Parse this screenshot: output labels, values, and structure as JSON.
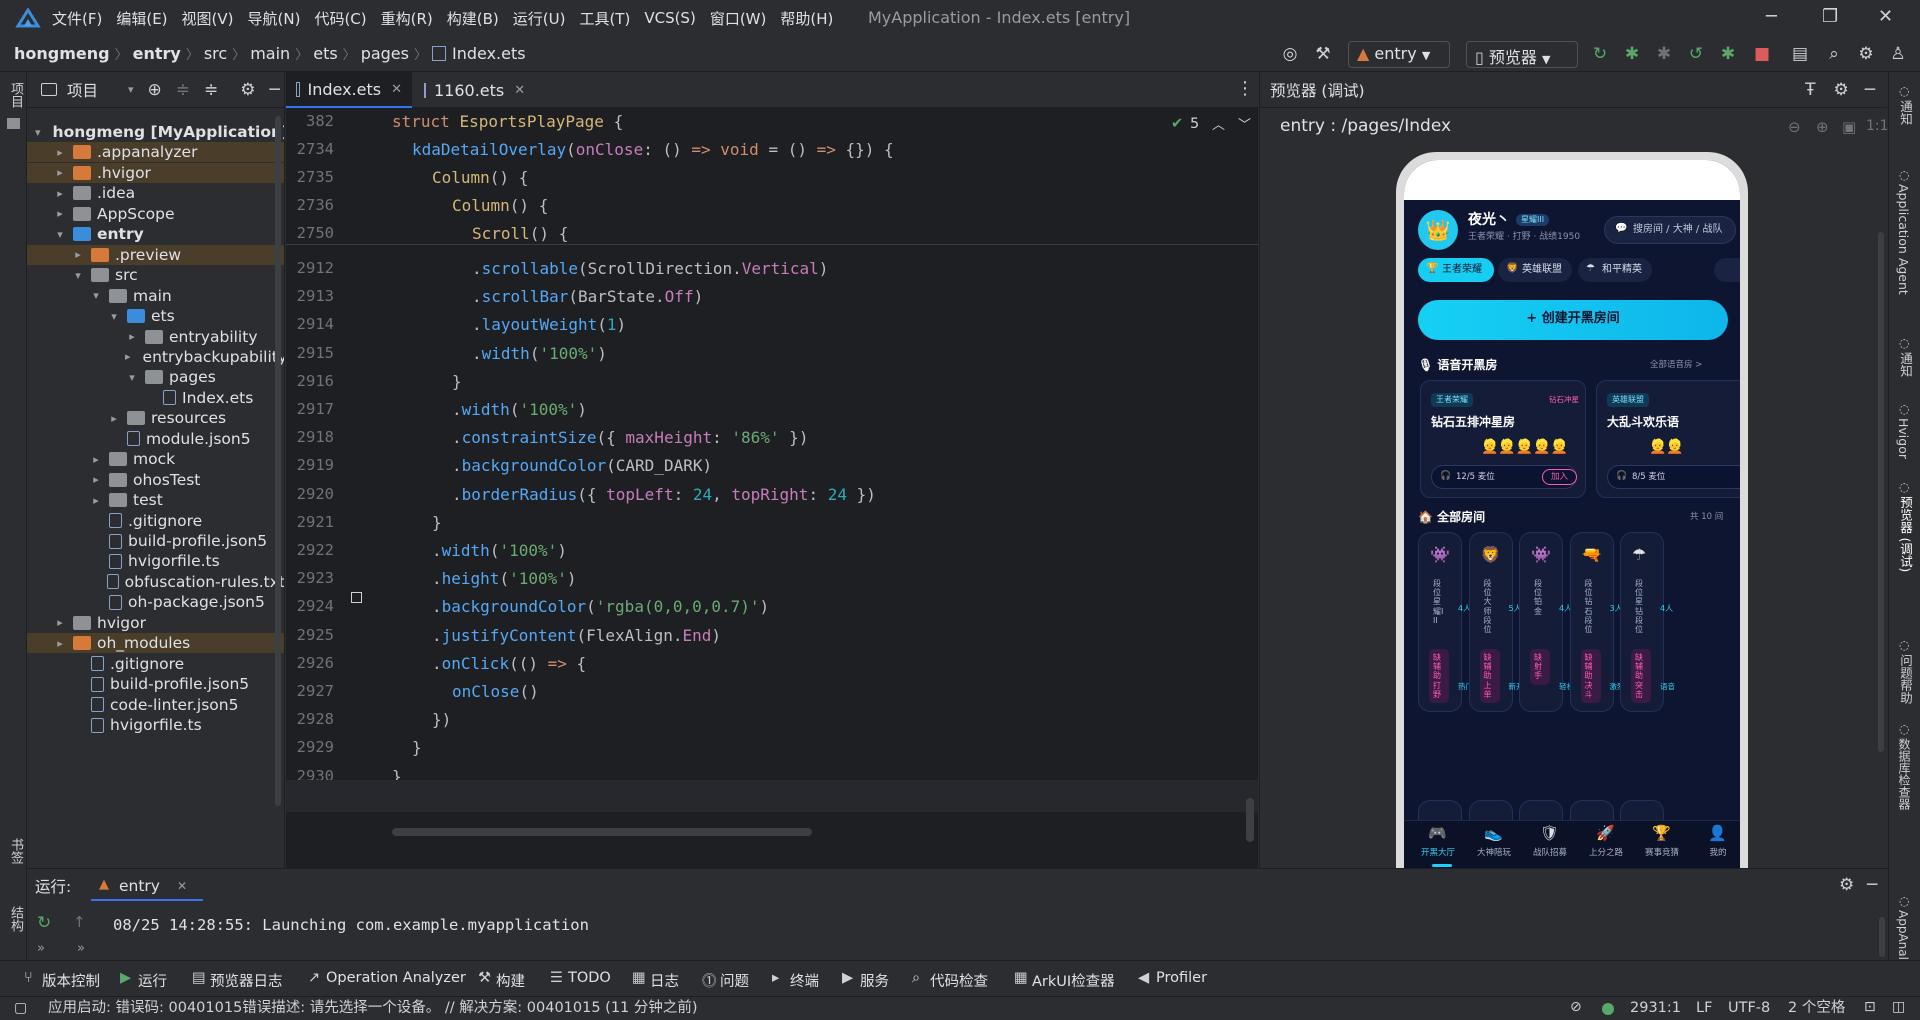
{
  "window": {
    "title": "MyApplication - Index.ets [entry]",
    "menus": [
      "文件(F)",
      "编辑(E)",
      "视图(V)",
      "导航(N)",
      "代码(C)",
      "重构(R)",
      "构建(B)",
      "运行(U)",
      "工具(T)",
      "VCS(S)",
      "窗口(W)",
      "帮助(H)"
    ]
  },
  "breadcrumb": [
    "hongmeng",
    "entry",
    "src",
    "main",
    "ets",
    "pages",
    "Index.ets"
  ],
  "toolbar": {
    "module": "entry",
    "device": "预览器"
  },
  "left_strip": {
    "project": "项目",
    "bookmarks": "书签",
    "structure": "结构"
  },
  "project_panel": {
    "title": "项目",
    "tree": [
      {
        "label": "hongmeng [MyApplication]",
        "depth": 0,
        "chev": "▾",
        "icon": "f-gray",
        "bold": true
      },
      {
        "label": ".appanalyzer",
        "depth": 1,
        "chev": "▸",
        "icon": "f-orange",
        "hl": true
      },
      {
        "label": ".hvigor",
        "depth": 1,
        "chev": "▸",
        "icon": "f-orange",
        "hl": true
      },
      {
        "label": ".idea",
        "depth": 1,
        "chev": "▸",
        "icon": "f-gray"
      },
      {
        "label": "AppScope",
        "depth": 1,
        "chev": "▸",
        "icon": "f-gray"
      },
      {
        "label": "entry",
        "depth": 1,
        "chev": "▾",
        "icon": "f-blue",
        "bold": true
      },
      {
        "label": ".preview",
        "depth": 2,
        "chev": "▸",
        "icon": "f-orange",
        "hl": true
      },
      {
        "label": "src",
        "depth": 2,
        "chev": "▾",
        "icon": "f-gray"
      },
      {
        "label": "main",
        "depth": 3,
        "chev": "▾",
        "icon": "f-gray"
      },
      {
        "label": "ets",
        "depth": 4,
        "chev": "▾",
        "icon": "f-blue"
      },
      {
        "label": "entryability",
        "depth": 5,
        "chev": "▸",
        "icon": "f-gray"
      },
      {
        "label": "entrybackupability",
        "depth": 5,
        "chev": "▸",
        "icon": "f-gray"
      },
      {
        "label": "pages",
        "depth": 5,
        "chev": "▾",
        "icon": "f-gray"
      },
      {
        "label": "Index.ets",
        "depth": 6,
        "chev": "",
        "icon": "f-file"
      },
      {
        "label": "resources",
        "depth": 4,
        "chev": "▸",
        "icon": "f-gray"
      },
      {
        "label": "module.json5",
        "depth": 4,
        "chev": "",
        "icon": "f-file"
      },
      {
        "label": "mock",
        "depth": 3,
        "chev": "▸",
        "icon": "f-gray"
      },
      {
        "label": "ohosTest",
        "depth": 3,
        "chev": "▸",
        "icon": "f-gray"
      },
      {
        "label": "test",
        "depth": 3,
        "chev": "▸",
        "icon": "f-gray"
      },
      {
        "label": ".gitignore",
        "depth": 3,
        "chev": "",
        "icon": "f-file"
      },
      {
        "label": "build-profile.json5",
        "depth": 3,
        "chev": "",
        "icon": "f-file"
      },
      {
        "label": "hvigorfile.ts",
        "depth": 3,
        "chev": "",
        "icon": "f-file"
      },
      {
        "label": "obfuscation-rules.txt",
        "depth": 3,
        "chev": "",
        "icon": "f-file"
      },
      {
        "label": "oh-package.json5",
        "depth": 3,
        "chev": "",
        "icon": "f-file"
      },
      {
        "label": "hvigor",
        "depth": 1,
        "chev": "▸",
        "icon": "f-gray"
      },
      {
        "label": "oh_modules",
        "depth": 1,
        "chev": "▸",
        "icon": "f-orange",
        "hl": true
      },
      {
        "label": ".gitignore",
        "depth": 2,
        "chev": "",
        "icon": "f-file"
      },
      {
        "label": "build-profile.json5",
        "depth": 2,
        "chev": "",
        "icon": "f-file"
      },
      {
        "label": "code-linter.json5",
        "depth": 2,
        "chev": "",
        "icon": "f-file"
      },
      {
        "label": "hvigorfile.ts",
        "depth": 2,
        "chev": "",
        "icon": "f-file"
      }
    ]
  },
  "editor_tabs": [
    "Index.ets",
    "1160.ets"
  ],
  "editor": {
    "inspection_count": "5",
    "sticky": [
      {
        "ln": "382",
        "ind": 0,
        "parts": [
          [
            "kw",
            "struct "
          ],
          [
            "dim",
            "EsportsPlayPage "
          ],
          [
            "plain",
            "{"
          ]
        ]
      },
      {
        "ln": "2734",
        "ind": 1,
        "parts": [
          [
            "fn",
            "kdaDetailOverlay"
          ],
          [
            "plain",
            "("
          ],
          [
            "pr",
            "onClose"
          ],
          [
            "plain",
            ": () "
          ],
          [
            "kw",
            "=> void"
          ],
          [
            "plain",
            " = () "
          ],
          [
            "kw",
            "=>"
          ],
          [
            "plain",
            " {}) {"
          ]
        ]
      },
      {
        "ln": "2735",
        "ind": 2,
        "parts": [
          [
            "dim",
            "Column"
          ],
          [
            "plain",
            "() {"
          ]
        ]
      },
      {
        "ln": "2736",
        "ind": 3,
        "parts": [
          [
            "dim",
            "Column"
          ],
          [
            "plain",
            "() {"
          ]
        ]
      },
      {
        "ln": "2750",
        "ind": 4,
        "parts": [
          [
            "dim",
            "Scroll"
          ],
          [
            "plain",
            "() {"
          ]
        ]
      }
    ],
    "lines": [
      {
        "ln": "2912",
        "ind": 4,
        "parts": [
          [
            "plain",
            "."
          ],
          [
            "fn",
            "scrollable"
          ],
          [
            "plain",
            "(ScrollDirection."
          ],
          [
            "cn",
            "Vertical"
          ],
          [
            "plain",
            ")"
          ]
        ]
      },
      {
        "ln": "2913",
        "ind": 4,
        "parts": [
          [
            "plain",
            "."
          ],
          [
            "fn",
            "scrollBar"
          ],
          [
            "plain",
            "(BarState."
          ],
          [
            "cn",
            "Off"
          ],
          [
            "plain",
            ")"
          ]
        ]
      },
      {
        "ln": "2914",
        "ind": 4,
        "parts": [
          [
            "plain",
            "."
          ],
          [
            "fn",
            "layoutWeight"
          ],
          [
            "plain",
            "("
          ],
          [
            "nu",
            "1"
          ],
          [
            "plain",
            ")"
          ]
        ]
      },
      {
        "ln": "2915",
        "ind": 4,
        "parts": [
          [
            "plain",
            "."
          ],
          [
            "fn",
            "width"
          ],
          [
            "plain",
            "("
          ],
          [
            "st",
            "'100%'"
          ],
          [
            "plain",
            ")"
          ]
        ]
      },
      {
        "ln": "2916",
        "ind": 3,
        "parts": [
          [
            "plain",
            "}"
          ]
        ]
      },
      {
        "ln": "2917",
        "ind": 3,
        "parts": [
          [
            "plain",
            "."
          ],
          [
            "fn",
            "width"
          ],
          [
            "plain",
            "("
          ],
          [
            "st",
            "'100%'"
          ],
          [
            "plain",
            ")"
          ]
        ]
      },
      {
        "ln": "2918",
        "ind": 3,
        "parts": [
          [
            "plain",
            "."
          ],
          [
            "fn",
            "constraintSize"
          ],
          [
            "plain",
            "({ "
          ],
          [
            "pr",
            "maxHeight"
          ],
          [
            "plain",
            ": "
          ],
          [
            "st",
            "'86%'"
          ],
          [
            "plain",
            " })"
          ]
        ]
      },
      {
        "ln": "2919",
        "ind": 3,
        "parts": [
          [
            "plain",
            "."
          ],
          [
            "fn",
            "backgroundColor"
          ],
          [
            "plain",
            "(CARD_DARK)"
          ]
        ]
      },
      {
        "ln": "2920",
        "ind": 3,
        "parts": [
          [
            "plain",
            "."
          ],
          [
            "fn",
            "borderRadius"
          ],
          [
            "plain",
            "({ "
          ],
          [
            "pr",
            "topLeft"
          ],
          [
            "plain",
            ": "
          ],
          [
            "nu",
            "24"
          ],
          [
            "plain",
            ", "
          ],
          [
            "pr",
            "topRight"
          ],
          [
            "plain",
            ": "
          ],
          [
            "nu",
            "24"
          ],
          [
            "plain",
            " })"
          ]
        ]
      },
      {
        "ln": "2921",
        "ind": 2,
        "parts": [
          [
            "plain",
            "}"
          ]
        ]
      },
      {
        "ln": "2922",
        "ind": 2,
        "parts": [
          [
            "plain",
            "."
          ],
          [
            "fn",
            "width"
          ],
          [
            "plain",
            "("
          ],
          [
            "st",
            "'100%'"
          ],
          [
            "plain",
            ")"
          ]
        ]
      },
      {
        "ln": "2923",
        "ind": 2,
        "parts": [
          [
            "plain",
            "."
          ],
          [
            "fn",
            "height"
          ],
          [
            "plain",
            "("
          ],
          [
            "st",
            "'100%'"
          ],
          [
            "plain",
            ")"
          ]
        ]
      },
      {
        "ln": "2924",
        "ind": 2,
        "parts": [
          [
            "plain",
            "."
          ],
          [
            "fn",
            "backgroundColor"
          ],
          [
            "plain",
            "("
          ],
          [
            "st",
            "'rgba(0,0,0,0.7)'"
          ],
          [
            "plain",
            ")"
          ]
        ]
      },
      {
        "ln": "2925",
        "ind": 2,
        "parts": [
          [
            "plain",
            "."
          ],
          [
            "fn",
            "justifyContent"
          ],
          [
            "plain",
            "(FlexAlign."
          ],
          [
            "cn",
            "End"
          ],
          [
            "plain",
            ")"
          ]
        ]
      },
      {
        "ln": "2926",
        "ind": 2,
        "parts": [
          [
            "plain",
            "."
          ],
          [
            "fn",
            "onClick"
          ],
          [
            "plain",
            "(() "
          ],
          [
            "kw",
            "=>"
          ],
          [
            "plain",
            " {"
          ]
        ]
      },
      {
        "ln": "2927",
        "ind": 3,
        "parts": [
          [
            "fn",
            "onClose"
          ],
          [
            "plain",
            "()"
          ]
        ]
      },
      {
        "ln": "2928",
        "ind": 2,
        "parts": [
          [
            "plain",
            "})"
          ]
        ]
      },
      {
        "ln": "2929",
        "ind": 1,
        "parts": [
          [
            "plain",
            "}"
          ]
        ]
      },
      {
        "ln": "2930",
        "ind": 0,
        "parts": [
          [
            "plain",
            "}"
          ]
        ]
      },
      {
        "ln": "2931",
        "ind": 0,
        "parts": [
          [
            "plain",
            ""
          ]
        ]
      }
    ]
  },
  "preview": {
    "title": "预览器 (调试)",
    "path": "entry : /pages/Index",
    "app": {
      "username": "夜光丶",
      "vip": "星耀III",
      "user_sub": "王者荣耀 · 打野 · 战绩1950",
      "search_placeholder": "搜房间 / 大神 / 战队",
      "games": [
        "王者荣耀",
        "英雄联盟",
        "和平精英"
      ],
      "create_btn": "+ 创建开黑房间",
      "voice_title": "语音开黑房",
      "voice_more": "全部语音房 >",
      "voice_rooms": [
        {
          "tag": "王者荣耀",
          "rank": "钻石冲星",
          "name": "钻石五排冲星房",
          "seats": "12/5 麦位",
          "join": "加入"
        },
        {
          "tag": "英雄联盟",
          "rank": "",
          "name": "大乱斗欢乐语",
          "seats": "8/5 麦位",
          "join": ""
        }
      ],
      "all_title": "全部房间",
      "all_count": "共 10 间",
      "rooms": [
        {
          "icon": "👾",
          "rank": "段位星耀III",
          "ppl": "4人",
          "need": "缺辅助打野",
          "tag": "热门"
        },
        {
          "icon": "🦁",
          "rank": "段位大师段位",
          "ppl": "5人",
          "need": "缺辅助上单",
          "tag": "新开"
        },
        {
          "icon": "👾",
          "rank": "段位铂金",
          "ppl": "4人",
          "need": "缺射手",
          "tag": "轻松"
        },
        {
          "icon": "🔫",
          "rank": "段位钻石段位",
          "ppl": "3人",
          "need": "缺辅助决斗",
          "tag": "激烈"
        },
        {
          "icon": "☂",
          "rank": "段位星钻段位",
          "ppl": "4人",
          "need": "缺辅助突击",
          "tag": "语音"
        }
      ],
      "nav": [
        {
          "icon": "🎮",
          "label": "开黑大厅"
        },
        {
          "icon": "👟",
          "label": "大神陪玩"
        },
        {
          "icon": "🛡",
          "label": "战队招募"
        },
        {
          "icon": "🚀",
          "label": "上分之路"
        },
        {
          "icon": "🏆",
          "label": "赛事竞猜"
        },
        {
          "icon": "👤",
          "label": "我的"
        }
      ]
    }
  },
  "right_strip": [
    "通知",
    "Application Agent",
    "通知",
    "Hvigor",
    "预览器 (调试)",
    "问题帮助",
    "数据库检查器",
    "AppAnaly"
  ],
  "run": {
    "label": "运行:",
    "tab": "entry",
    "log": "08/25 14:28:55: Launching com.example.myapplication"
  },
  "bottom_tools": [
    "版本控制",
    "运行",
    "预览器日志",
    "Operation Analyzer",
    "构建",
    "TODO",
    "日志",
    "问题",
    "终端",
    "服务",
    "代码检查",
    "ArkUI检查器",
    "Profiler"
  ],
  "status": {
    "message": "应用启动: 错误码: 00401015错误描述: 请先选择一个设备。 // 解决方案: 00401015 (11 分钟之前)",
    "pos": "2931:1",
    "eol": "LF",
    "enc": "UTF-8",
    "indent": "2 个空格"
  },
  "colors": {
    "accent": "#3574f0",
    "cyan": "#00c8f0",
    "bg": "#2b2d30",
    "editor": "#1e1f22"
  }
}
